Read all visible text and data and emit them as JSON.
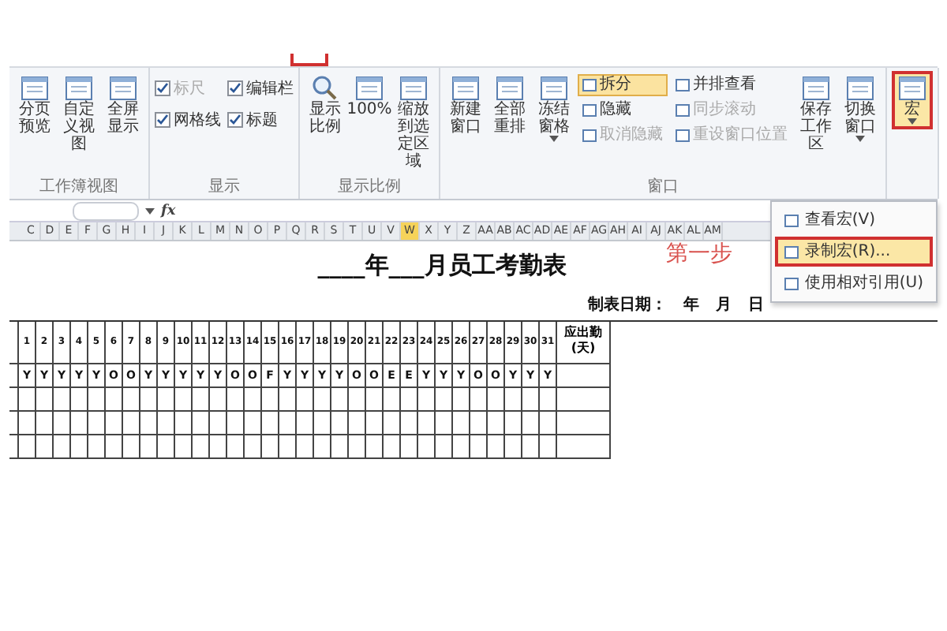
{
  "ribbon": {
    "groups": [
      {
        "label": "工作簿视图",
        "items": [
          {
            "kind": "large",
            "label": "分页预览",
            "highlighted": false
          },
          {
            "kind": "large",
            "label": "自定义视图",
            "highlighted": false
          },
          {
            "kind": "large",
            "label": "全屏显示",
            "highlighted": false
          }
        ]
      },
      {
        "label": "显示",
        "items": [
          {
            "kind": "check",
            "label": "标尺",
            "checked": true,
            "disabled": true
          },
          {
            "kind": "check",
            "label": "编辑栏",
            "checked": true,
            "disabled": false
          },
          {
            "kind": "check",
            "label": "网格线",
            "checked": true,
            "disabled": false
          },
          {
            "kind": "check",
            "label": "标题",
            "checked": true,
            "disabled": false
          }
        ]
      },
      {
        "label": "显示比例",
        "items": [
          {
            "kind": "zoom",
            "label": "显示比例",
            "highlighted": false
          },
          {
            "kind": "large",
            "label": "100%",
            "highlighted": false
          },
          {
            "kind": "large",
            "label": "缩放到选定区域",
            "highlighted": false
          }
        ]
      },
      {
        "label": "窗口",
        "items": [
          {
            "kind": "large",
            "label": "新建窗口",
            "highlighted": false
          },
          {
            "kind": "large",
            "label": "全部重排",
            "highlighted": false
          },
          {
            "kind": "menu",
            "label": "冻结窗格",
            "highlighted": false
          },
          {
            "kind": "stack",
            "items": [
              {
                "label": "拆分",
                "on": true,
                "disabled": false
              },
              {
                "label": "隐藏",
                "on": false,
                "disabled": false
              },
              {
                "label": "取消隐藏",
                "on": false,
                "disabled": true
              }
            ]
          },
          {
            "kind": "stack",
            "items": [
              {
                "label": "并排查看",
                "on": false,
                "disabled": false
              },
              {
                "label": "同步滚动",
                "on": false,
                "disabled": true
              },
              {
                "label": "重设窗口位置",
                "on": false,
                "disabled": true
              }
            ]
          },
          {
            "kind": "large",
            "label": "保存工作区",
            "highlighted": false
          },
          {
            "kind": "menu",
            "label": "切换窗口",
            "highlighted": false
          }
        ]
      },
      {
        "items": [
          {
            "kind": "menu",
            "label": "宏",
            "highlighted": true
          }
        ]
      }
    ]
  },
  "macro_menu": {
    "items": [
      {
        "label": "查看宏(V)",
        "highlighted": false
      },
      {
        "label": "录制宏(R)...",
        "highlighted": true
      },
      {
        "label": "使用相对引用(U)",
        "highlighted": false
      }
    ]
  },
  "step_label": "第一步",
  "formula_bar": {
    "fx_label": "fx"
  },
  "column_headers": [
    {
      "label": "C",
      "selected": false
    },
    {
      "label": "D",
      "selected": false
    },
    {
      "label": "E",
      "selected": false
    },
    {
      "label": "F",
      "selected": false
    },
    {
      "label": "G",
      "selected": false
    },
    {
      "label": "H",
      "selected": false
    },
    {
      "label": "I",
      "selected": false
    },
    {
      "label": "J",
      "selected": false
    },
    {
      "label": "K",
      "selected": false
    },
    {
      "label": "L",
      "selected": false
    },
    {
      "label": "M",
      "selected": false
    },
    {
      "label": "N",
      "selected": false
    },
    {
      "label": "O",
      "selected": false
    },
    {
      "label": "P",
      "selected": false
    },
    {
      "label": "Q",
      "selected": false
    },
    {
      "label": "R",
      "selected": false
    },
    {
      "label": "S",
      "selected": false
    },
    {
      "label": "T",
      "selected": false
    },
    {
      "label": "U",
      "selected": false
    },
    {
      "label": "V",
      "selected": false
    },
    {
      "label": "W",
      "selected": true
    },
    {
      "label": "X",
      "selected": false
    },
    {
      "label": "Y",
      "selected": false
    },
    {
      "label": "Z",
      "selected": false
    },
    {
      "label": "AA",
      "selected": false
    },
    {
      "label": "AB",
      "selected": false
    },
    {
      "label": "AC",
      "selected": false
    },
    {
      "label": "AD",
      "selected": false
    },
    {
      "label": "AE",
      "selected": false
    },
    {
      "label": "AF",
      "selected": false
    },
    {
      "label": "AG",
      "selected": false
    },
    {
      "label": "AH",
      "selected": false
    },
    {
      "label": "AI",
      "selected": false
    },
    {
      "label": "AJ",
      "selected": false
    },
    {
      "label": "AK",
      "selected": false
    },
    {
      "label": "AL",
      "selected": false
    },
    {
      "label": "AM",
      "selected": false
    }
  ],
  "sheet": {
    "title": "____年___月员工考勤表",
    "date_line": "制表日期：   年   月   日",
    "day_headers": [
      "1",
      "2",
      "3",
      "4",
      "5",
      "6",
      "7",
      "8",
      "9",
      "10",
      "11",
      "12",
      "13",
      "14",
      "15",
      "16",
      "17",
      "18",
      "19",
      "20",
      "21",
      "22",
      "23",
      "24",
      "25",
      "26",
      "27",
      "28",
      "29",
      "30",
      "31"
    ],
    "total_header": "应出勤(天)",
    "status": [
      "Y",
      "Y",
      "Y",
      "Y",
      "Y",
      "O",
      "O",
      "Y",
      "Y",
      "Y",
      "Y",
      "Y",
      "O",
      "O",
      "F",
      "Y",
      "Y",
      "Y",
      "Y",
      "O",
      "O",
      "E",
      "E",
      "Y",
      "Y",
      "Y",
      "O",
      "O",
      "Y",
      "Y",
      "Y"
    ]
  }
}
